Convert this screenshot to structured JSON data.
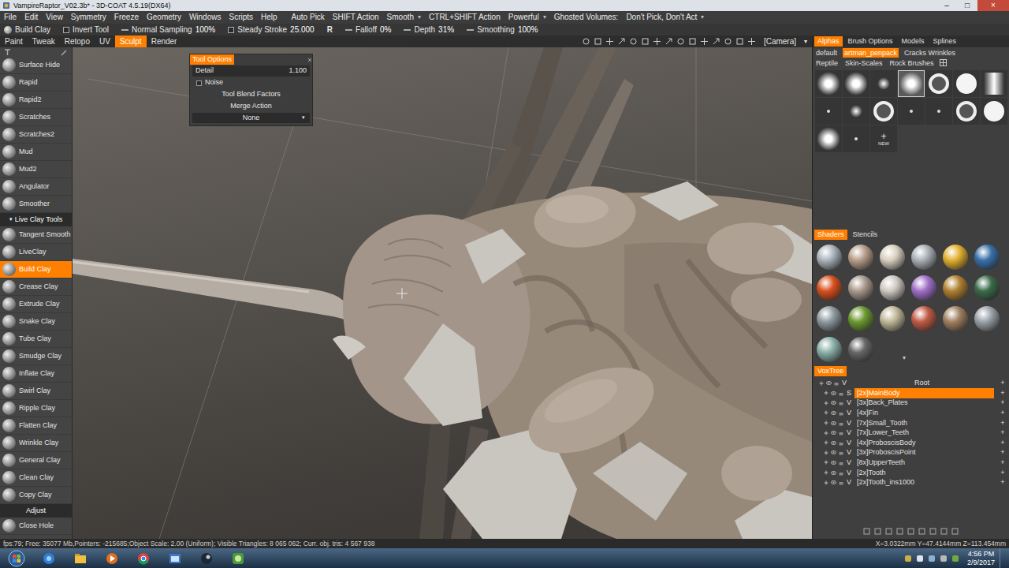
{
  "window": {
    "title": "VampireRaptor_V02.3b* - 3D-COAT 4.5.19(DX64)",
    "controls": [
      "–",
      "□",
      "×"
    ]
  },
  "menu": [
    {
      "label": "File",
      "kind": "menu"
    },
    {
      "label": "Edit",
      "kind": "menu"
    },
    {
      "label": "View",
      "kind": "menu"
    },
    {
      "label": "Symmetry",
      "kind": "menu"
    },
    {
      "label": "Freeze",
      "kind": "menu"
    },
    {
      "label": "Geometry",
      "kind": "menu"
    },
    {
      "label": "Windows",
      "kind": "menu"
    },
    {
      "label": "Scripts",
      "kind": "menu"
    },
    {
      "label": "Help",
      "kind": "menu"
    },
    {
      "label": "Auto Pick",
      "kind": "option"
    },
    {
      "label": "SHIFT Action",
      "kind": "option"
    },
    {
      "label": "Smooth",
      "kind": "dropdown",
      "arrow": "▾"
    },
    {
      "label": "CTRL+SHIFT Action",
      "kind": "option"
    },
    {
      "label": "Powerful",
      "kind": "dropdown",
      "arrow": "▾"
    },
    {
      "label": "Ghosted Volumes:",
      "kind": "option"
    },
    {
      "label": "Don't Pick, Don't Act",
      "kind": "dropdown",
      "arrow": "▾"
    }
  ],
  "toolbar": [
    {
      "label": "Build Clay",
      "kind": "tool"
    },
    {
      "label": "Invert Tool",
      "kind": "checkbox",
      "checked": false
    },
    {
      "label": "Normal Sampling",
      "value": "100%",
      "kind": "field"
    },
    {
      "label": "Steady Stroke",
      "value": "25.000",
      "kind": "checkbox",
      "checked": false
    },
    {
      "label": "R",
      "kind": "toggle"
    },
    {
      "label": "Falloff",
      "value": "0%",
      "kind": "field"
    },
    {
      "label": "Depth",
      "value": "31%",
      "kind": "field"
    },
    {
      "label": "Smoothing",
      "value": "100%",
      "kind": "field"
    }
  ],
  "rooms": [
    {
      "label": "Paint",
      "selected": false
    },
    {
      "label": "Tweak",
      "selected": false
    },
    {
      "label": "Retopo",
      "selected": false
    },
    {
      "label": "UV",
      "selected": false
    },
    {
      "label": "Sculpt",
      "selected": true
    },
    {
      "label": "Render",
      "selected": false
    }
  ],
  "viewport": {
    "camera": "[Camera]",
    "arrow": "▾"
  },
  "panel_tabs": [
    {
      "label": "Alphas",
      "selected": true
    },
    {
      "label": "Brush Options",
      "selected": false
    },
    {
      "label": "Models",
      "selected": false
    },
    {
      "label": "Splines",
      "selected": false
    }
  ],
  "tool_options": {
    "title": "Tool Options",
    "fields": [
      {
        "kind": "slider",
        "label": "Detail",
        "value": "1.100"
      },
      {
        "kind": "checkbox",
        "label": "Noise",
        "checked": false
      },
      {
        "kind": "button",
        "label": "Tool Blend Factors"
      },
      {
        "kind": "button",
        "label": "Merge Action"
      },
      {
        "kind": "dropdown",
        "label": "None",
        "arrow": "▾"
      }
    ]
  },
  "tools": [
    {
      "label": "Surface Hide",
      "kind": "tool",
      "selected": false
    },
    {
      "label": "Rapid",
      "kind": "tool",
      "selected": false
    },
    {
      "label": "Rapid2",
      "kind": "tool",
      "selected": false
    },
    {
      "label": "Scratches",
      "kind": "tool",
      "selected": false
    },
    {
      "label": "Scratches2",
      "kind": "tool",
      "selected": false
    },
    {
      "label": "Mud",
      "kind": "tool",
      "selected": false
    },
    {
      "label": "Mud2",
      "kind": "tool",
      "selected": false
    },
    {
      "label": "Angulator",
      "kind": "tool",
      "selected": false
    },
    {
      "label": "Smoother",
      "kind": "tool",
      "selected": false
    },
    {
      "label": "Live Clay Tools",
      "kind": "header",
      "arrow": "▾"
    },
    {
      "label": "Tangent Smooth",
      "kind": "tool",
      "selected": false
    },
    {
      "label": "LiveClay",
      "kind": "tool",
      "selected": false
    },
    {
      "label": "Build Clay",
      "kind": "tool",
      "selected": true
    },
    {
      "label": "Crease Clay",
      "kind": "tool",
      "selected": false
    },
    {
      "label": "Extrude Clay",
      "kind": "tool",
      "selected": false
    },
    {
      "label": "Snake Clay",
      "kind": "tool",
      "selected": false
    },
    {
      "label": "Tube Clay",
      "kind": "tool",
      "selected": false
    },
    {
      "label": "Smudge Clay",
      "kind": "tool",
      "selected": false
    },
    {
      "label": "Inflate Clay",
      "kind": "tool",
      "selected": false
    },
    {
      "label": "Swirl Clay",
      "kind": "tool",
      "selected": false
    },
    {
      "label": "Ripple Clay",
      "kind": "tool",
      "selected": false
    },
    {
      "label": "Flatten Clay",
      "kind": "tool",
      "selected": false
    },
    {
      "label": "Wrinkle Clay",
      "kind": "tool",
      "selected": false
    },
    {
      "label": "General Clay",
      "kind": "tool",
      "selected": false
    },
    {
      "label": "Clean Clay",
      "kind": "tool",
      "selected": false
    },
    {
      "label": "Copy Clay",
      "kind": "tool",
      "selected": false
    },
    {
      "label": "Adjust",
      "kind": "header"
    },
    {
      "label": "Close Hole",
      "kind": "tool",
      "selected": false
    }
  ],
  "alpha_sets": [
    [
      {
        "label": "default",
        "selected": false
      },
      {
        "label": "artman_penpack",
        "selected": true
      },
      {
        "label": "Cracks Wrinkles",
        "selected": false
      }
    ],
    [
      {
        "label": "Reptile",
        "selected": false
      },
      {
        "label": "Skin-Scales",
        "selected": false
      },
      {
        "label": "Rock Brushes",
        "selected": false
      }
    ]
  ],
  "alphas": [
    {
      "kind": "soft",
      "selected": false
    },
    {
      "kind": "soft",
      "selected": false
    },
    {
      "kind": "small",
      "selected": false
    },
    {
      "kind": "soft",
      "selected": true
    },
    {
      "kind": "ring",
      "selected": false
    },
    {
      "kind": "hard",
      "selected": false
    },
    {
      "kind": "stripe",
      "selected": false
    },
    {
      "kind": "dot",
      "selected": false
    },
    {
      "kind": "small",
      "selected": false
    },
    {
      "kind": "ring",
      "selected": false
    },
    {
      "kind": "dot",
      "selected": false
    },
    {
      "kind": "dot",
      "selected": false
    },
    {
      "kind": "ring",
      "selected": false
    },
    {
      "kind": "hard",
      "selected": false
    },
    {
      "kind": "soft",
      "selected": false
    },
    {
      "kind": "dot",
      "selected": false
    },
    {
      "kind": "new",
      "selected": false,
      "icon": "+",
      "label": "NEW"
    }
  ],
  "shader_tabs": [
    {
      "label": "Shaders",
      "selected": true
    },
    {
      "label": "Stencils",
      "selected": false
    }
  ],
  "shaders": [
    {
      "color": "#aab4bc"
    },
    {
      "color": "#b89e8a"
    },
    {
      "color": "#d8cfc0"
    },
    {
      "color": "#a9b0b6"
    },
    {
      "color": "#e0b030"
    },
    {
      "color": "#3a6fa8"
    },
    {
      "color": "#d8501e"
    },
    {
      "color": "#a99a8c"
    },
    {
      "color": "#cfc8c0"
    },
    {
      "color": "#a070c8"
    },
    {
      "color": "#b08030"
    },
    {
      "color": "#3b6a4a"
    },
    {
      "color": "#8f9aa0"
    },
    {
      "color": "#6c9a30"
    },
    {
      "color": "#c0b898"
    },
    {
      "color": "#c05a44"
    },
    {
      "color": "#a08060"
    },
    {
      "color": "#9aa2a8"
    },
    {
      "color": "#8ab0a8"
    },
    {
      "color": "#666666"
    }
  ],
  "shader_more": "▾",
  "voxtree": {
    "title": "VoxTree",
    "root": "Root",
    "root_mode": "V",
    "add": "+",
    "items": [
      {
        "mode": "S",
        "label": "[2x]MainBody",
        "selected": true
      },
      {
        "mode": "V",
        "label": "[3x]Back_Plates",
        "selected": false
      },
      {
        "mode": "V",
        "label": "[4x]Fin",
        "selected": false
      },
      {
        "mode": "V",
        "label": "[7x]Small_Tooth",
        "selected": false
      },
      {
        "mode": "V",
        "label": "[7x]Lower_Teeth",
        "selected": false
      },
      {
        "mode": "V",
        "label": "[4x]ProboscisBody",
        "selected": false
      },
      {
        "mode": "V",
        "label": "[3x]ProboscisPoint",
        "selected": false
      },
      {
        "mode": "V",
        "label": "[8x]UpperTeeth",
        "selected": false
      },
      {
        "mode": "V",
        "label": "[2x]Tooth",
        "selected": false
      },
      {
        "mode": "V",
        "label": "[2x]Tooth_ins1000",
        "selected": false
      }
    ]
  },
  "status": {
    "left": "fps:79; Free: 35077 Mb,Pointers: -215685;Object Scale: 2.00 (Uniform); Visible Triangles: 8 065 062; Curr. obj. tris: 4 567 938",
    "right": "X=3.0322mm Y=47.4144mm Z=113.454mm"
  },
  "taskbar": {
    "time": "4:56 PM",
    "date": "2/9/2017"
  }
}
